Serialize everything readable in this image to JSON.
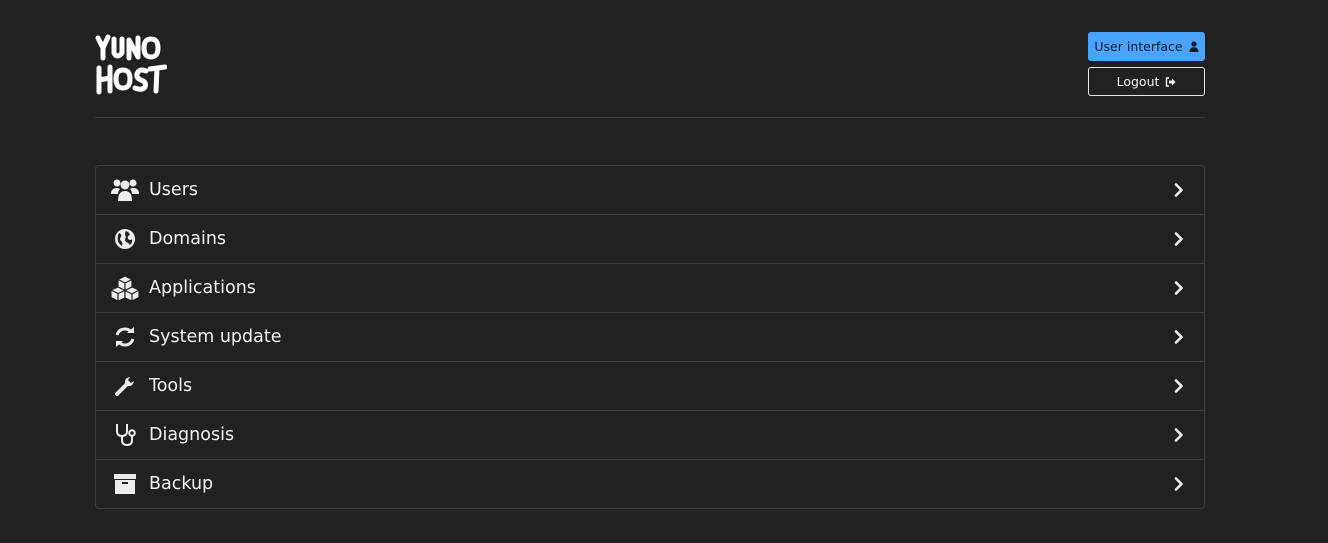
{
  "header": {
    "logo_text": "YUNOHOST",
    "user_interface_label": "User interface",
    "logout_label": "Logout"
  },
  "menu": {
    "items": [
      {
        "label": "Users",
        "icon": "users-icon"
      },
      {
        "label": "Domains",
        "icon": "globe-icon"
      },
      {
        "label": "Applications",
        "icon": "cubes-icon"
      },
      {
        "label": "System update",
        "icon": "refresh-icon"
      },
      {
        "label": "Tools",
        "icon": "wrench-icon"
      },
      {
        "label": "Diagnosis",
        "icon": "stethoscope-icon"
      },
      {
        "label": "Backup",
        "icon": "archive-icon"
      }
    ]
  },
  "colors": {
    "background": "#212121",
    "primary": "#4aa3ff",
    "border": "#3c3c3c",
    "text": "#ededed"
  }
}
